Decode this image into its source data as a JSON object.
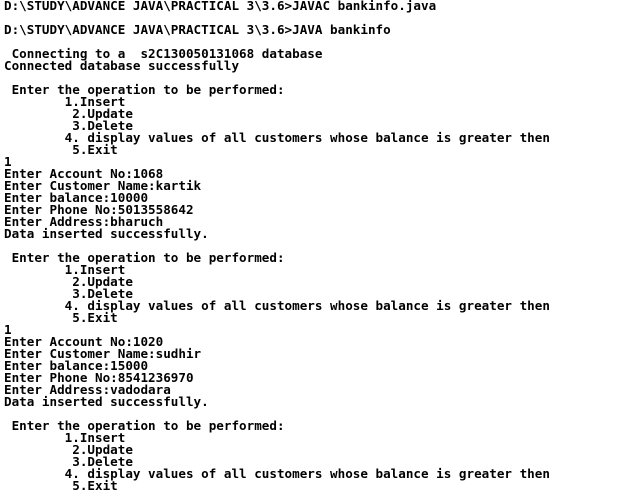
{
  "console": {
    "text_color": "#000000",
    "background_color": "#ffffff",
    "lines": [
      "D:\\STUDY\\ADVANCE JAVA\\PRACTICAL 3\\3.6>JAVAC bankinfo.java",
      "",
      "D:\\STUDY\\ADVANCE JAVA\\PRACTICAL 3\\3.6>JAVA bankinfo",
      "",
      " Connecting to a  s2C130050131068 database",
      "Connected database successfully",
      "",
      " Enter the operation to be performed:",
      "        1.Insert",
      "         2.Update",
      "         3.Delete",
      "        4. display values of all customers whose balance is greater then",
      "         5.Exit",
      "1",
      "Enter Account No:1068",
      "Enter Customer Name:kartik",
      "Enter balance:10000",
      "Enter Phone No:5013558642",
      "Enter Address:bharuch",
      "Data inserted successfully.",
      "",
      " Enter the operation to be performed:",
      "        1.Insert",
      "         2.Update",
      "         3.Delete",
      "        4. display values of all customers whose balance is greater then",
      "         5.Exit",
      "1",
      "Enter Account No:1020",
      "Enter Customer Name:sudhir",
      "Enter balance:15000",
      "Enter Phone No:8541236970",
      "Enter Address:vadodara",
      "Data inserted successfully.",
      "",
      " Enter the operation to be performed:",
      "        1.Insert",
      "         2.Update",
      "         3.Delete",
      "        4. display values of all customers whose balance is greater then",
      "         5.Exit"
    ]
  }
}
